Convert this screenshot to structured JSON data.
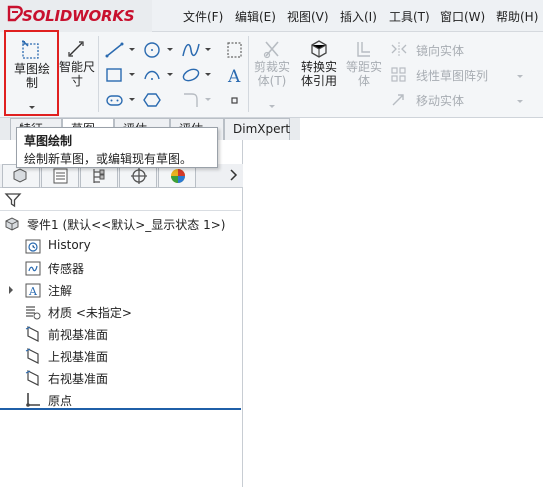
{
  "app": {
    "logo_text": "SOLIDWORKS"
  },
  "menu": [
    "文件(F)",
    "编辑(E)",
    "视图(V)",
    "插入(I)",
    "工具(T)",
    "窗口(W)",
    "帮助(H)"
  ],
  "toolbar": {
    "sketch_label_1": "草图绘",
    "sketch_label_2": "制",
    "smart_dim_1": "智能尺",
    "smart_dim_2": "寸",
    "trim_1": "剪裁实",
    "trim_2": "体(T)",
    "convert_1": "转换实",
    "convert_2": "体引用",
    "offset_1": "等距实",
    "offset_2": "体",
    "mirror": "镜向实体",
    "linear_pattern": "线性草图阵列",
    "move": "移动实体"
  },
  "tabs": [
    "特征",
    "草图",
    "评估",
    "评估",
    "DimXpert"
  ],
  "tooltip": {
    "title": "草图绘制",
    "desc": "绘制新草图，或编辑现有草图。"
  },
  "tree": {
    "root": "零件1  (默认<<默认>_显示状态 1>)",
    "items": [
      "History",
      "传感器",
      "注解",
      "材质 <未指定>",
      "前视基准面",
      "上视基准面",
      "右视基准面",
      "原点"
    ]
  },
  "colors": {
    "brand": "#c8102e",
    "highlight": "#e02020",
    "accent": "#1f5fa8"
  }
}
